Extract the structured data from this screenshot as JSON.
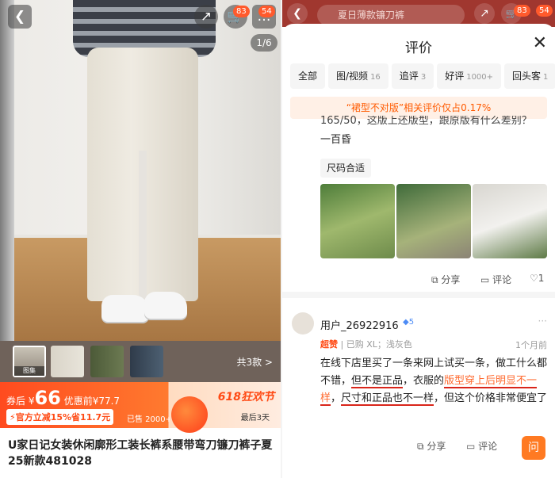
{
  "left": {
    "cart_badge": "83",
    "msg_badge": "54",
    "pager": "1/6",
    "watermark": "",
    "thumb_label": "图集",
    "thumbs_total": "共3款 >",
    "price": {
      "prefix": "券后 ¥",
      "amount": "66",
      "original": "优惠前¥77.7"
    },
    "coupon": "⚡官方立减15%省11.7元",
    "sold": "已售 2000+",
    "promo": {
      "title": "618狂欢节",
      "sub": "最后3天"
    },
    "product_title": "U家日记女装休闲廓形工装长裤系腰带弯刀镰刀裤子夏25新款481028"
  },
  "right": {
    "search_placeholder": "夏日薄款镰刀裤",
    "cart_badge": "83",
    "msg_badge": "54",
    "sheet_title": "评价",
    "tabs": [
      {
        "label": "全部",
        "count": ""
      },
      {
        "label": "图/视频",
        "count": "16"
      },
      {
        "label": "追评",
        "count": "3"
      },
      {
        "label": "好评",
        "count": "1000+"
      },
      {
        "label": "回头客",
        "count": "1"
      }
    ],
    "notice": "“裙型不对版”相关评价仅占0.17%",
    "review1": {
      "line1": "165/50，这版上还版型，跟原版有什么差别？",
      "line2": "一百昏",
      "tag": "尺码合适",
      "share": "分享",
      "comment": "评论",
      "likes": "1"
    },
    "review2": {
      "user": "用户_26922916",
      "level": "5",
      "badge": "超赞",
      "meta": "已购 XL；浅灰色",
      "date": "1个月前",
      "t1": "在线下店里买了一条来网上试买一条，做工什么都不错，",
      "t2": "但不是正品",
      "t3": "，衣服的",
      "t4": "版型穿上后明显不一样",
      "t5": "，",
      "t6": "尺寸和正品也不一样",
      "t7": "，但这个价格非常便宜了",
      "share": "分享",
      "comment": "评论",
      "ask": "问"
    }
  },
  "colors": {
    "accent": "#ff4a14",
    "underline": "#d9251a",
    "highlight": "#ff6a2f"
  }
}
